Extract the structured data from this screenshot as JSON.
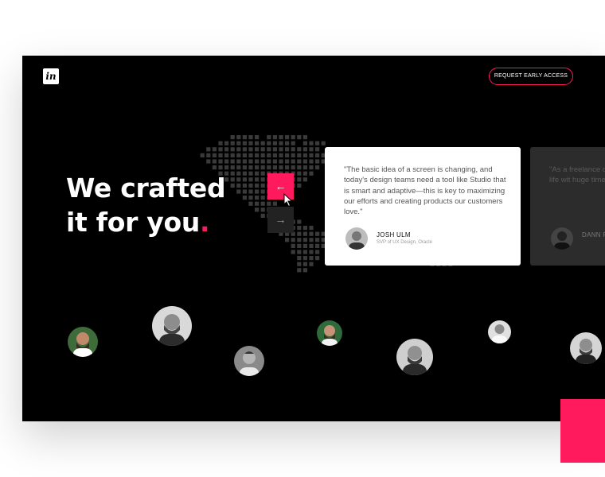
{
  "brand": {
    "logo_text": "in"
  },
  "header": {
    "cta_label": "REQUEST EARLY ACCESS"
  },
  "hero": {
    "headline_line1": "We crafted",
    "headline_line2": "it for you",
    "headline_dot": "."
  },
  "carousel": {
    "prev_icon": "arrow-left-icon",
    "next_icon": "arrow-right-icon",
    "prev_glyph": "←",
    "next_glyph": "→",
    "cards": [
      {
        "quote": "\"The basic idea of a screen is changing, and today's design teams need a tool like Studio that is smart and adaptive—this is key to maximizing our efforts and creating products our customers love.\"",
        "author": "JOSH ULM",
        "role": "SVP of UX Design, Oracle"
      },
      {
        "quote": "\"As a freelance d improve my pitc ideas to life wit huge timesaver",
        "author": "DANN P",
        "role": ""
      }
    ]
  },
  "colors": {
    "accent": "#ff1a5e",
    "background": "#000000",
    "map_dot": "#3a3a3a"
  }
}
